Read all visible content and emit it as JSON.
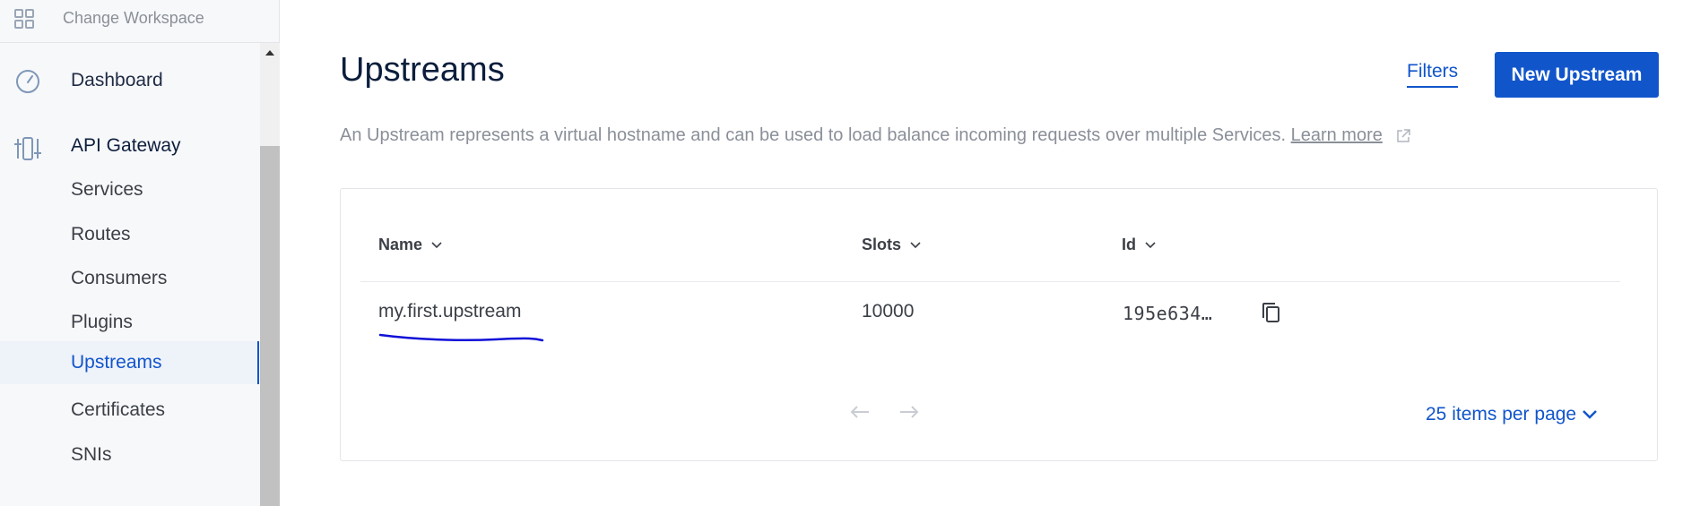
{
  "sidebar": {
    "workspace_label": "Change Workspace",
    "dashboard": "Dashboard",
    "api_gateway": "API Gateway",
    "items": [
      {
        "label": "Services"
      },
      {
        "label": "Routes"
      },
      {
        "label": "Consumers"
      },
      {
        "label": "Plugins"
      },
      {
        "label": "Upstreams"
      },
      {
        "label": "Certificates"
      },
      {
        "label": "SNIs"
      }
    ],
    "active_item": "Upstreams"
  },
  "header": {
    "title": "Upstreams",
    "filters_label": "Filters",
    "new_button_label": "New Upstream"
  },
  "description": {
    "text": "An Upstream represents a virtual hostname and can be used to load balance incoming requests over multiple Services.",
    "learn_more": "Learn more"
  },
  "table": {
    "columns": [
      "Name",
      "Slots",
      "Id"
    ],
    "rows": [
      {
        "name": "my.first.upstream",
        "slots": "10000",
        "id": "195e634…"
      }
    ]
  },
  "pagination": {
    "per_page_label": "25 items per page"
  },
  "icons": {
    "workspace": "grid-icon",
    "dashboard": "gauge-icon",
    "api_gateway": "sliders-icon",
    "external": "external-link-icon",
    "copy": "copy-icon"
  },
  "colors": {
    "accent": "#1155cb",
    "title": "#0c1e3c",
    "muted": "#8a8f98",
    "annotation": "#1010d8"
  }
}
